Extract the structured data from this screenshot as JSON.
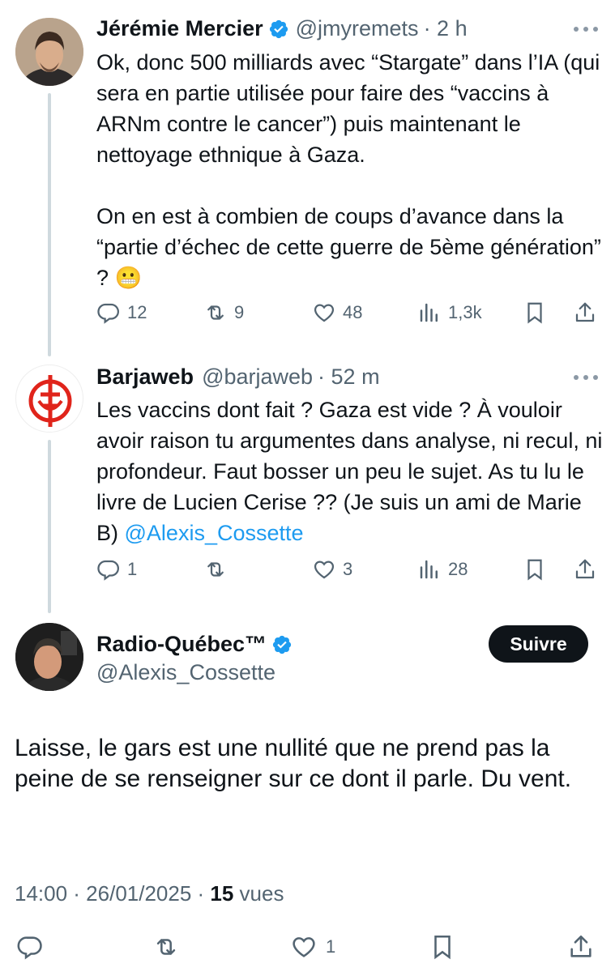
{
  "tweets": [
    {
      "name": "Jérémie Mercier",
      "handle": "@jmyremets",
      "time": "· 2 h",
      "text": "Ok, donc 500 milliards avec “Stargate” dans l’IA (qui sera en partie utilisée pour faire des “vaccins à ARNm contre le cancer”) puis maintenant le nettoyage ethnique à Gaza.\n\nOn en est à combien de coups d’avance dans la “partie d’échec de cette guerre de 5ème génération” ?",
      "emoji": "😬",
      "replies": "12",
      "reposts": "9",
      "likes": "48",
      "views": "1,3k"
    },
    {
      "name": "Barjaweb",
      "handle": "@barjaweb",
      "time": "· 52 m",
      "text": "Les vaccins dont fait ? Gaza est vide ? À vouloir avoir raison tu argumentes dans analyse, ni recul, ni profondeur. Faut bosser un peu le sujet. As tu lu le livre de Lucien Cerise ?? (Je suis un ami de Marie B)",
      "mention": "@Alexis_Cossette",
      "replies": "1",
      "reposts": "",
      "likes": "3",
      "views": "28"
    }
  ],
  "main": {
    "name": "Radio-Québec™",
    "handle": "@Alexis_Cossette",
    "follow_label": "Suivre",
    "text": "Laisse, le gars est une nullité que ne prend pas la peine de se renseigner sur ce dont il parle. Du vent.",
    "timestamp": "14:00 · 26/01/2025 · ",
    "views_count": "15",
    "views_label": " vues",
    "likes": "1"
  },
  "colors": {
    "accent": "#1d9bf0",
    "text": "#0f1419",
    "muted": "#536471",
    "line": "#cfd9de"
  }
}
